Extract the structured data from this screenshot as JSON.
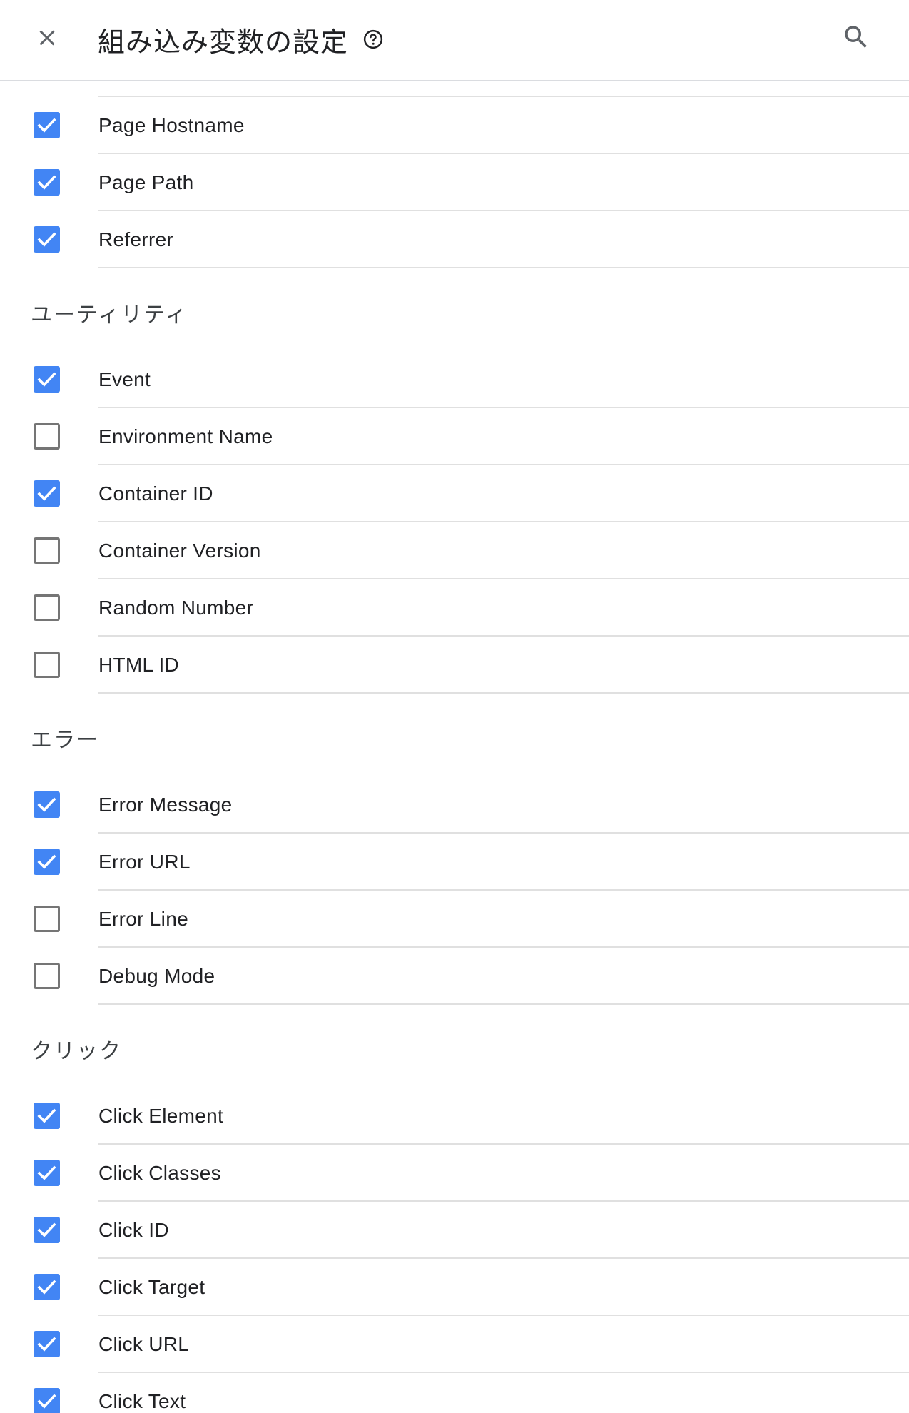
{
  "header": {
    "title": "組み込み変数の設定",
    "close_icon": "close-icon",
    "help_icon": "help-circle-icon",
    "search_icon": "search-icon"
  },
  "colors": {
    "checkbox_checked": "#4285f4",
    "checkbox_unchecked_border": "#757575",
    "divider": "#e0e0e0",
    "text": "#202124"
  },
  "sections": [
    {
      "title": "",
      "items": [
        {
          "label": "Page Hostname",
          "checked": true
        },
        {
          "label": "Page Path",
          "checked": true
        },
        {
          "label": "Referrer",
          "checked": true
        }
      ]
    },
    {
      "title": "ユーティリティ",
      "items": [
        {
          "label": "Event",
          "checked": true
        },
        {
          "label": "Environment Name",
          "checked": false
        },
        {
          "label": "Container ID",
          "checked": true
        },
        {
          "label": "Container Version",
          "checked": false
        },
        {
          "label": "Random Number",
          "checked": false
        },
        {
          "label": "HTML ID",
          "checked": false
        }
      ]
    },
    {
      "title": "エラー",
      "items": [
        {
          "label": "Error Message",
          "checked": true
        },
        {
          "label": "Error URL",
          "checked": true
        },
        {
          "label": "Error Line",
          "checked": false
        },
        {
          "label": "Debug Mode",
          "checked": false
        }
      ]
    },
    {
      "title": "クリック",
      "items": [
        {
          "label": "Click Element",
          "checked": true
        },
        {
          "label": "Click Classes",
          "checked": true
        },
        {
          "label": "Click ID",
          "checked": true
        },
        {
          "label": "Click Target",
          "checked": true
        },
        {
          "label": "Click URL",
          "checked": true
        },
        {
          "label": "Click Text",
          "checked": true
        }
      ]
    }
  ]
}
